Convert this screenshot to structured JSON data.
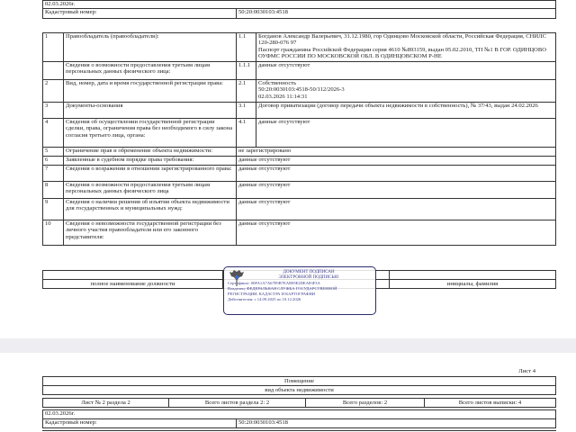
{
  "top": {
    "date": "02.03.2026г.",
    "cad_label": "Кадастровый номер:",
    "cad_value": "50:20:0030103:4518"
  },
  "rows": [
    {
      "n": "1",
      "label": "Правообладатель (правообладатели):",
      "sub": "1.1",
      "value": "Богданов Александр Валерьевич, 31.12.1980, гор Одинцово Московской области, Российская Федерация, СНИЛС 120-280-076 97",
      "value2": "Паспорт гражданина Российской Федерации серия 4610 №893159, выдан 05.02.2010, ТП №1 В ГОР. ОДИНЦОВО ОУФМС РОССИИ ПО МОСКОВСКОЙ ОБЛ. В ОДИНЦОВСКОМ Р-НЕ"
    },
    {
      "n": "",
      "label": "Сведения о возможности предоставления третьим лицам персональных данных физического лица:",
      "sub": "1.1.1",
      "value": "данные отсутствуют"
    },
    {
      "n": "2",
      "label": "Вид, номер, дата и время государственной регистрации права:",
      "sub": "2.1",
      "value": "Собственность",
      "value2": "50:20:0030103:4518-50/112/2026-3",
      "value3": "02.03.2026 11:14:31"
    },
    {
      "n": "3",
      "label": "Документы-основания",
      "sub": "3.1",
      "value": "Договор приватизации (договор передачи объекта недвижимости в собственность), № 37/43, выдан 24.02.2026"
    },
    {
      "n": "4",
      "label": "Сведения об осуществлении государственной регистрации сделки, права, ограничения права без необходимого в силу закона согласия третьего лица, органа:",
      "sub": "4.1",
      "value": "данные отсутствуют"
    }
  ],
  "rows_wide": [
    {
      "n": "5",
      "label": "Ограничение прав и обременение объекта недвижимости:",
      "value": "не зарегистрировано"
    },
    {
      "n": "6",
      "label": "Заявленные в судебном порядке права требования:",
      "value": "данные отсутствуют"
    },
    {
      "n": "7",
      "label": "Сведения о возражении в отношении зарегистрированного права:",
      "value": "данные отсутствуют"
    },
    {
      "n": "8",
      "label": "Сведения о возможности предоставления третьим лицам персональных данных физического лица",
      "value": "данные отсутствуют"
    },
    {
      "n": "9",
      "label": "Сведения о наличии решения об изъятии объекта недвижимости для государственных и муниципальных нужд:",
      "value": "данные отсутствуют"
    },
    {
      "n": "10",
      "label": "Сведения о невозможности государственной регистрации без личного участия правообладателя или его законного представителя:",
      "value": "данные отсутствуют"
    }
  ],
  "signature": {
    "position_caption": "полное наименование должности",
    "name_caption": "инициалы, фамилия"
  },
  "stamp": {
    "line1": "ДОКУМЕНТ ПОДПИСАН",
    "line2": "ЭЛЕКТРОННОЙ ПОДПИСЬЮ",
    "cert": "Сертификат: 00FA1A7A67F0B7EA8E9E2DEA83F3A",
    "owner": "Владелец: ФЕДЕРАЛЬНАЯ СЛУЖБА ГОСУДАРСТВЕННОЙ",
    "owner2": "РЕГИСТРАЦИИ, КАДАСТРА И КАРТОГРАФИИ",
    "valid": "Действителен: с 14.09.2025 по 10.12.2026"
  },
  "page2": {
    "sheet": "Лист 4",
    "object": "Помещение",
    "object_caption": "вид объекта недвижимости",
    "sheet_no": "Лист № 2 раздела 2",
    "sheets_section": "Всего листов раздела 2: 2",
    "sections": "Всего разделов: 2",
    "sheets_total": "Всего листов выписки: 4",
    "date": "02.03.2026г.",
    "cad_label": "Кадастровый номер:",
    "cad_value": "50:20:0030103:4518"
  }
}
